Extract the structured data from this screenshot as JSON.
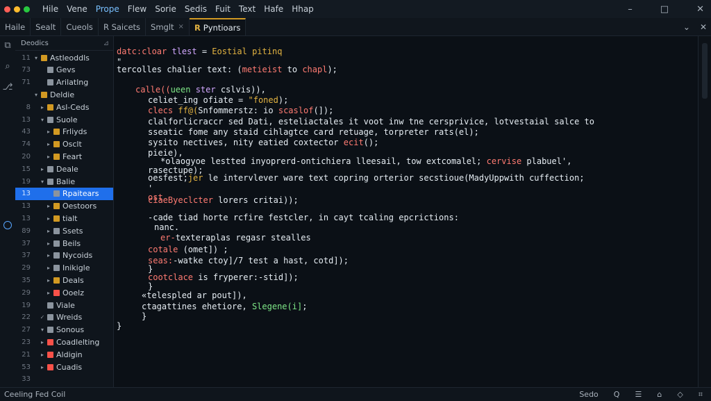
{
  "titlebar": {
    "menu": [
      "Hile",
      "Vene",
      "Prope",
      "Flew",
      "Sorie",
      "Sedis",
      "Fuit",
      "Text",
      "Hafe",
      "Hhap"
    ],
    "active_menu_index": 2,
    "dots": [
      "#ff5f57",
      "#febc2e",
      "#28c840"
    ],
    "controls": [
      "–",
      "□",
      "✕"
    ]
  },
  "tabs": [
    {
      "label": "Haile",
      "active": false
    },
    {
      "label": "Sealt",
      "active": false
    },
    {
      "label": "Cueols",
      "active": false
    },
    {
      "label": "R Saicets",
      "active": false
    },
    {
      "label": "Smglt",
      "active": false,
      "close": "×"
    },
    {
      "label": "Pyntioars",
      "active": true,
      "icon": "R"
    }
  ],
  "tab_controls": [
    "⌄",
    "✕"
  ],
  "sidebar": {
    "header": "Deodics",
    "pin": "⊿",
    "items": [
      {
        "ln": "11",
        "caret": "▾",
        "label": "Astleoddls",
        "color": "#d29922",
        "indent": 0
      },
      {
        "ln": "73",
        "caret": "",
        "label": "Gevs",
        "color": "#8b949e",
        "indent": 1
      },
      {
        "ln": "71",
        "caret": "",
        "label": "Arilatlng",
        "color": "#8b949e",
        "indent": 1
      },
      {
        "ln": "",
        "caret": "▾",
        "label": "Deldie",
        "color": "#d29922",
        "indent": 0
      },
      {
        "ln": "8",
        "caret": "▸",
        "label": "Asl-Ceds",
        "color": "#d29922",
        "indent": 1
      },
      {
        "ln": "13",
        "caret": "▾",
        "label": "Suole",
        "color": "#8b949e",
        "indent": 1
      },
      {
        "ln": "43",
        "caret": "▸",
        "label": "Frliyds",
        "color": "#d29922",
        "indent": 2
      },
      {
        "ln": "74",
        "caret": "▸",
        "label": "Osclt",
        "color": "#d29922",
        "indent": 2
      },
      {
        "ln": "20",
        "caret": "▸",
        "label": "Feart",
        "color": "#d29922",
        "indent": 2
      },
      {
        "ln": "15",
        "caret": "▸",
        "label": "Deale",
        "color": "#8b949e",
        "indent": 1
      },
      {
        "ln": "19",
        "caret": "▾",
        "label": "Balie",
        "color": "#8b949e",
        "indent": 1
      },
      {
        "ln": "13",
        "caret": "",
        "label": "Rpaitears",
        "color": "#8b949e",
        "indent": 2,
        "selected": true
      },
      {
        "ln": "13",
        "caret": "▸",
        "label": "Oestoors",
        "color": "#d29922",
        "indent": 2
      },
      {
        "ln": "13",
        "caret": "▸",
        "label": "tialt",
        "color": "#d29922",
        "indent": 2
      },
      {
        "ln": "89",
        "caret": "▸",
        "label": "Ssets",
        "color": "#8b949e",
        "indent": 2
      },
      {
        "ln": "37",
        "caret": "▸",
        "label": "Beils",
        "color": "#8b949e",
        "indent": 2
      },
      {
        "ln": "37",
        "caret": "▸",
        "label": "Nycoids",
        "color": "#8b949e",
        "indent": 2
      },
      {
        "ln": "29",
        "caret": "▸",
        "label": "Inikigle",
        "color": "#8b949e",
        "indent": 2
      },
      {
        "ln": "35",
        "caret": "▸",
        "label": "Deals",
        "color": "#d29922",
        "indent": 2
      },
      {
        "ln": "29",
        "caret": "▸",
        "label": "Ooelz",
        "color": "#f85149",
        "indent": 2
      },
      {
        "ln": "19",
        "caret": "",
        "label": "Viale",
        "color": "#8b949e",
        "indent": 1
      },
      {
        "ln": "22",
        "caret": "✓",
        "label": "Wreids",
        "color": "#8b949e",
        "indent": 1
      },
      {
        "ln": "27",
        "caret": "▾",
        "label": "Sonous",
        "color": "#8b949e",
        "indent": 1
      },
      {
        "ln": "23",
        "caret": "▸",
        "label": "Coadlelting",
        "color": "#f85149",
        "indent": 1
      },
      {
        "ln": "21",
        "caret": "▸",
        "label": "Aldigin",
        "color": "#f85149",
        "indent": 1
      },
      {
        "ln": "53",
        "caret": "▸",
        "label": "Cuadis",
        "color": "#f85149",
        "indent": 1
      },
      {
        "ln": "33",
        "caret": "",
        "label": "",
        "color": "",
        "indent": 0
      }
    ]
  },
  "code_lines": [
    {
      "text": "datc:cloar tlest = Eostial pitinq",
      "color": "multi1",
      "indent": 0
    },
    {
      "text": "\"",
      "color": "wht",
      "indent": 0
    },
    {
      "text": "tercolles chalier text: (metieist to chapl);",
      "color": "multi2",
      "indent": 0
    },
    {
      "text": "calle((ueen ster cslvis)),",
      "color": "multi3",
      "indent": 3
    },
    {
      "text": "celiet_ing ofiate = \"foned);",
      "color": "multi4",
      "indent": 5
    },
    {
      "text": "clecs ff@(Snfommerstz: io scaslof(]);",
      "color": "multi5",
      "indent": 5
    },
    {
      "text": "clalforlicraccr sed Dati, esteliactales it voot inw tne cersprivice, lotvestaial salce to",
      "color": "wht",
      "indent": 5
    },
    {
      "text": "sseatic fome any staid cihlagtce card retuage, torpreter rats(el);",
      "color": "wht",
      "indent": 5
    },
    {
      "text": "sysito nectives, nity eatied coxtector ecit();",
      "color": "multi6",
      "indent": 5
    },
    {
      "text": "pieie),",
      "color": "wht",
      "indent": 5
    },
    {
      "text": "*olaogyoe lestted inyoprerd-ontichiera lleesail, tow extcomalel; cervise plabuel',",
      "color": "multi7",
      "indent": 7
    },
    {
      "text": "rasectupe);",
      "color": "wht",
      "indent": 5
    },
    {
      "text": "oesfest;jer le intervlever ware text copring orterior secstioue(MadyUppwith cuffection;",
      "color": "multi8",
      "indent": 5
    },
    {
      "text": "'",
      "color": "wht",
      "indent": 5
    },
    {
      "text": "ost",
      "color": "kw",
      "indent": 5
    },
    {
      "text": "ciaeByeclcter lorers critai));",
      "color": "multi9",
      "indent": 5
    },
    {
      "text": "",
      "color": "wht",
      "indent": 0
    },
    {
      "text": "-cade tiad horte rcfire festcler, in cayt tcaling epcrictions:",
      "color": "wht",
      "indent": 5
    },
    {
      "text": "nanc.",
      "color": "wht",
      "indent": 6
    },
    {
      "text": "er-texteraplas regasr stealles",
      "color": "multi10",
      "indent": 7
    },
    {
      "text": "",
      "color": "wht",
      "indent": 0
    },
    {
      "text": "cotale (omet]) ;",
      "color": "multi11",
      "indent": 5
    },
    {
      "text": "seas:-watke ctoy]/7 test a hast, cotd]);",
      "color": "multi12",
      "indent": 5
    },
    {
      "text": "}",
      "color": "wht",
      "indent": 5
    },
    {
      "text": "cootclace is fryperer:-stid]);",
      "color": "multi13",
      "indent": 5
    },
    {
      "text": "}",
      "color": "wht",
      "indent": 5
    },
    {
      "text": "«telespled ar pout]),",
      "color": "wht",
      "indent": 4
    },
    {
      "text": "ctagattines ehetiore, Slegene(i];",
      "color": "multi14",
      "indent": 4
    },
    {
      "text": "}",
      "color": "wht",
      "indent": 4
    },
    {
      "text": "}",
      "color": "wht",
      "indent": 0
    }
  ],
  "status": {
    "left": "Ceeling Fed Coil",
    "right": [
      "Sedo",
      "Q",
      "☰",
      "⌂",
      "◇",
      "⌗"
    ]
  }
}
